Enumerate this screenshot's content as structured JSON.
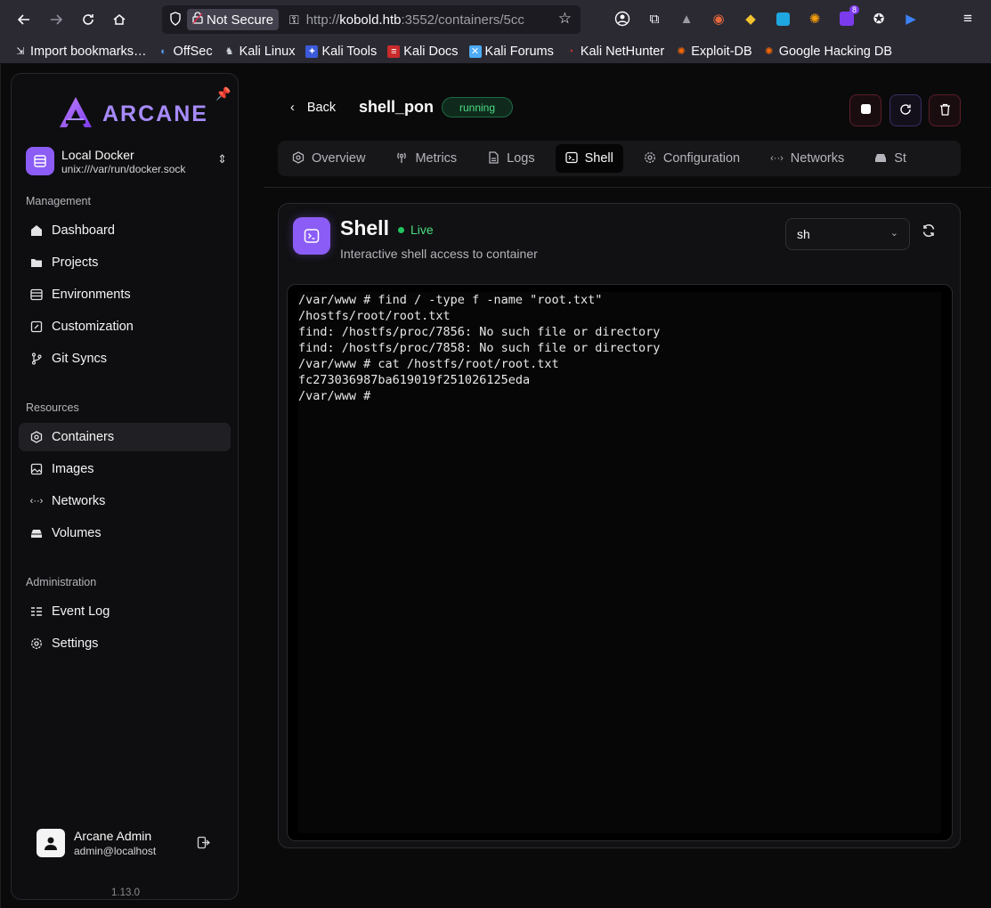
{
  "browser": {
    "not_secure_label": "Not Secure",
    "url_prefix": "http://",
    "url_host": "kobold.htb",
    "url_rest": ":3552/containers/5cc",
    "bookmarks": [
      {
        "label": "Import bookmarks…",
        "icon": "import-icon"
      },
      {
        "label": "OffSec",
        "icon": "offsec-icon"
      },
      {
        "label": "Kali Linux",
        "icon": "kali-icon"
      },
      {
        "label": "Kali Tools",
        "icon": "kali-tools-icon"
      },
      {
        "label": "Kali Docs",
        "icon": "kali-docs-icon"
      },
      {
        "label": "Kali Forums",
        "icon": "kali-forums-icon"
      },
      {
        "label": "Kali NetHunter",
        "icon": "nethunter-icon"
      },
      {
        "label": "Exploit-DB",
        "icon": "exploit-db-icon"
      },
      {
        "label": "Google Hacking DB",
        "icon": "ghdb-icon"
      }
    ],
    "extension_badge": "8"
  },
  "sidebar": {
    "logo_text": "ARCANE",
    "environment": {
      "name": "Local Docker",
      "path": "unix:///var/run/docker.sock"
    },
    "sections": {
      "management": "Management",
      "resources": "Resources",
      "administration": "Administration"
    },
    "items": {
      "dashboard": "Dashboard",
      "projects": "Projects",
      "environments": "Environments",
      "customization": "Customization",
      "git_syncs": "Git Syncs",
      "containers": "Containers",
      "images": "Images",
      "networks": "Networks",
      "volumes": "Volumes",
      "event_log": "Event Log",
      "settings": "Settings"
    },
    "active_item": "Containers",
    "user": {
      "name": "Arcane Admin",
      "email": "admin@localhost"
    },
    "version": "1.13.0"
  },
  "header": {
    "back_label": "Back",
    "container_name": "shell_pon",
    "status": "running",
    "status_color": "#4ade80"
  },
  "tabs": [
    {
      "label": "Overview",
      "icon": "overview-icon"
    },
    {
      "label": "Metrics",
      "icon": "metrics-icon"
    },
    {
      "label": "Logs",
      "icon": "logs-icon"
    },
    {
      "label": "Shell",
      "icon": "terminal-icon"
    },
    {
      "label": "Configuration",
      "icon": "gear-icon"
    },
    {
      "label": "Networks",
      "icon": "network-icon"
    },
    {
      "label": "St",
      "icon": "storage-icon"
    }
  ],
  "active_tab": "Shell",
  "shell": {
    "title": "Shell",
    "live_label": "Live",
    "subtitle": "Interactive shell access to container",
    "shell_select": "sh",
    "terminal_lines": [
      "/var/www # find / -type f -name \"root.txt\"",
      "/hostfs/root/root.txt",
      "find: /hostfs/proc/7856: No such file or directory",
      "find: /hostfs/proc/7858: No such file or directory",
      "/var/www # cat /hostfs/root/root.txt",
      "fc273036987ba619019f251026125eda",
      "/var/www # "
    ]
  },
  "colors": {
    "accent": "#8b5cf6",
    "running": "#4ade80"
  }
}
